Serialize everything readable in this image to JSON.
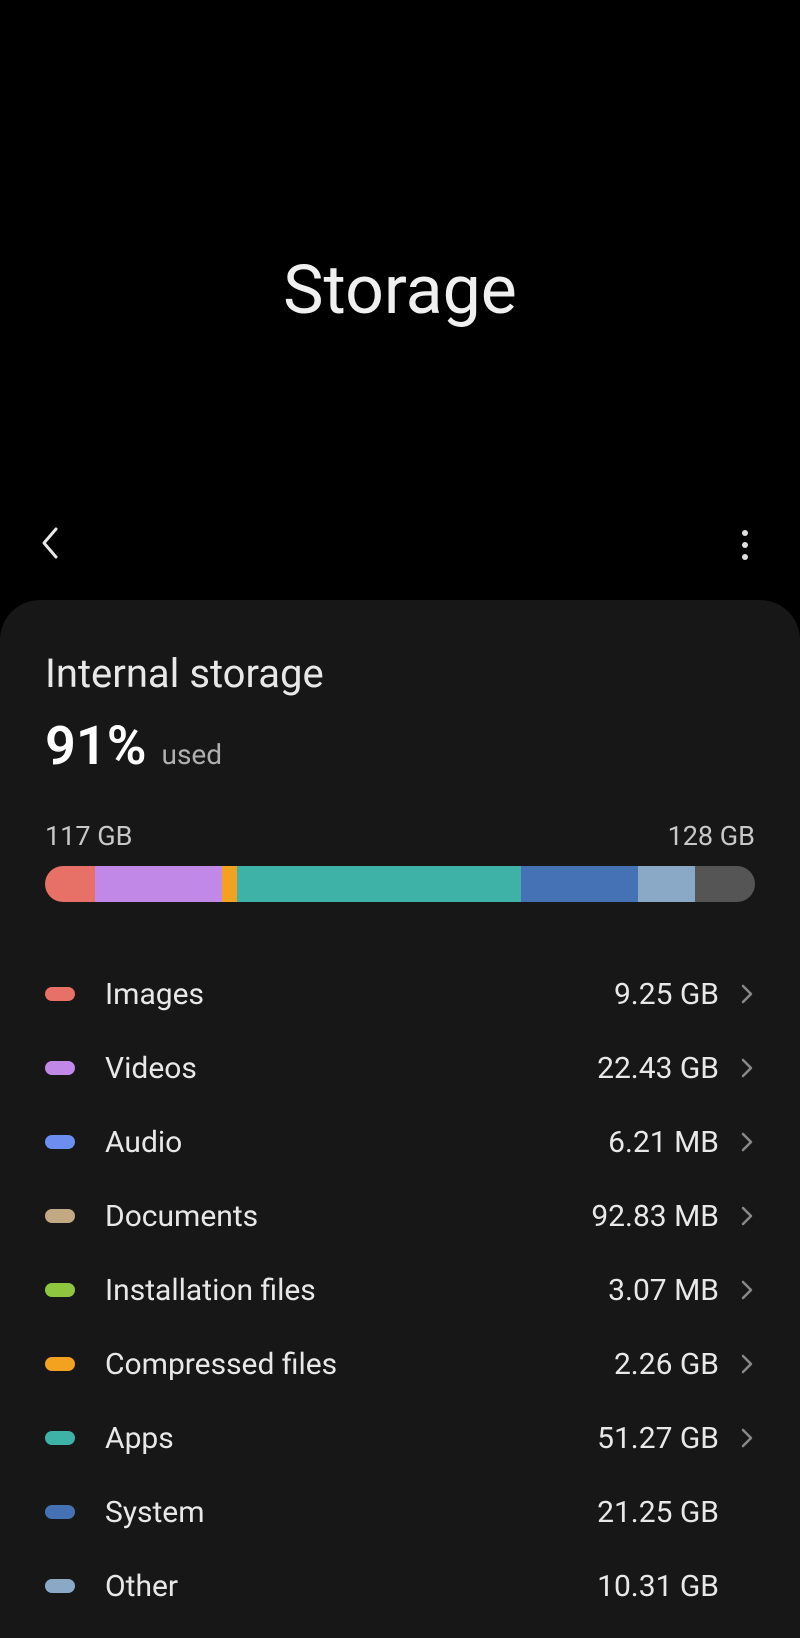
{
  "header": {
    "title": "Storage"
  },
  "storage": {
    "title": "Internal storage",
    "percent": "91%",
    "used_label": "used",
    "used_value": "117 GB",
    "total_value": "128 GB"
  },
  "bar_segments": [
    {
      "color": "#e77067",
      "width": 7
    },
    {
      "color": "#c188e8",
      "width": 18
    },
    {
      "color": "#f2a21e",
      "width": 2
    },
    {
      "color": "#3fb2a8",
      "width": 40
    },
    {
      "color": "#4572b5",
      "width": 16.5
    },
    {
      "color": "#8aa9c6",
      "width": 8
    },
    {
      "color": "#555555",
      "width": 8.5
    }
  ],
  "categories": [
    {
      "color": "#e77067",
      "label": "Images",
      "value": "9.25 GB",
      "clickable": true
    },
    {
      "color": "#c188e8",
      "label": "Videos",
      "value": "22.43 GB",
      "clickable": true
    },
    {
      "color": "#6c8ef0",
      "label": "Audio",
      "value": "6.21 MB",
      "clickable": true
    },
    {
      "color": "#c2a984",
      "label": "Documents",
      "value": "92.83 MB",
      "clickable": true
    },
    {
      "color": "#8fc63f",
      "label": "Installation files",
      "value": "3.07 MB",
      "clickable": true
    },
    {
      "color": "#f2a21e",
      "label": "Compressed files",
      "value": "2.26 GB",
      "clickable": true
    },
    {
      "color": "#3fb2a8",
      "label": "Apps",
      "value": "51.27 GB",
      "clickable": true
    },
    {
      "color": "#4572b5",
      "label": "System",
      "value": "21.25 GB",
      "clickable": false
    },
    {
      "color": "#8aa9c6",
      "label": "Other",
      "value": "10.31 GB",
      "clickable": false
    }
  ],
  "chart_data": {
    "type": "bar",
    "title": "Internal storage usage",
    "total_gb": 128,
    "used_gb": 117,
    "used_percent": 91,
    "series": [
      {
        "name": "Images",
        "value": 9.25,
        "unit": "GB"
      },
      {
        "name": "Videos",
        "value": 22.43,
        "unit": "GB"
      },
      {
        "name": "Audio",
        "value": 6.21,
        "unit": "MB"
      },
      {
        "name": "Documents",
        "value": 92.83,
        "unit": "MB"
      },
      {
        "name": "Installation files",
        "value": 3.07,
        "unit": "MB"
      },
      {
        "name": "Compressed files",
        "value": 2.26,
        "unit": "GB"
      },
      {
        "name": "Apps",
        "value": 51.27,
        "unit": "GB"
      },
      {
        "name": "System",
        "value": 21.25,
        "unit": "GB"
      },
      {
        "name": "Other",
        "value": 10.31,
        "unit": "GB"
      }
    ]
  }
}
